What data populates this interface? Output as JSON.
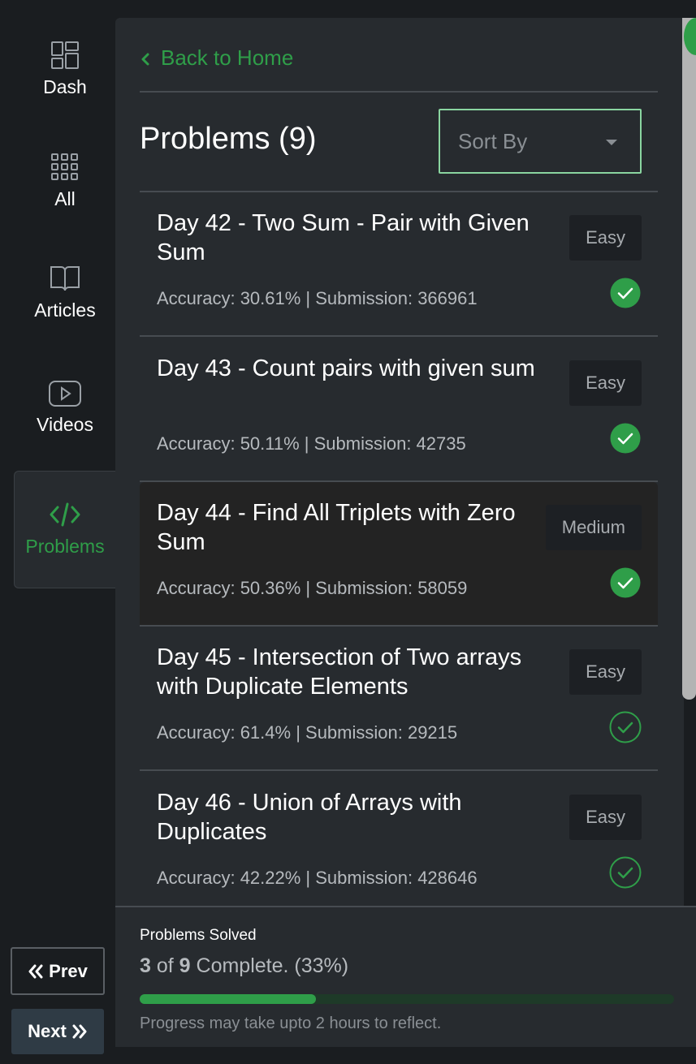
{
  "sidebar": {
    "items": [
      {
        "label": "Dash",
        "icon": "dashboard-icon"
      },
      {
        "label": "All",
        "icon": "grid-icon"
      },
      {
        "label": "Articles",
        "icon": "book-icon"
      },
      {
        "label": "Videos",
        "icon": "play-icon"
      },
      {
        "label": "Problems",
        "icon": "code-icon"
      }
    ],
    "prev_label": "Prev",
    "next_label": "Next"
  },
  "header": {
    "back_label": "Back to Home",
    "title": "Problems (9)",
    "sort_placeholder": "Sort By"
  },
  "problems": [
    {
      "name": "Day 42 - Two Sum - Pair with Given Sum",
      "meta": "Accuracy: 30.61% | Submission: 366961",
      "difficulty": "Easy",
      "solved": true
    },
    {
      "name": "Day 43 - Count pairs with given sum",
      "meta": "Accuracy: 50.11% | Submission: 42735",
      "difficulty": "Easy",
      "solved": true
    },
    {
      "name": "Day 44 - Find All Triplets with Zero Sum",
      "meta": "Accuracy: 50.36% | Submission: 58059",
      "difficulty": "Medium",
      "solved": true
    },
    {
      "name": "Day 45 - Intersection of Two arrays with Duplicate Elements",
      "meta": "Accuracy: 61.4% | Submission: 29215",
      "difficulty": "Easy",
      "solved": false
    },
    {
      "name": "Day 46 - Union of Arrays with Duplicates",
      "meta": "Accuracy: 42.22% | Submission: 428646",
      "difficulty": "Easy",
      "solved": false
    }
  ],
  "progress": {
    "label": "Problems Solved",
    "solved": "3",
    "total": "9",
    "status_rest": "Complete. (33%)",
    "fraction": 0.33,
    "note": "Progress may take upto 2 hours to reflect."
  },
  "colors": {
    "accent": "#2f9e49",
    "background": "#1a1d20",
    "panel": "#272b2f"
  }
}
